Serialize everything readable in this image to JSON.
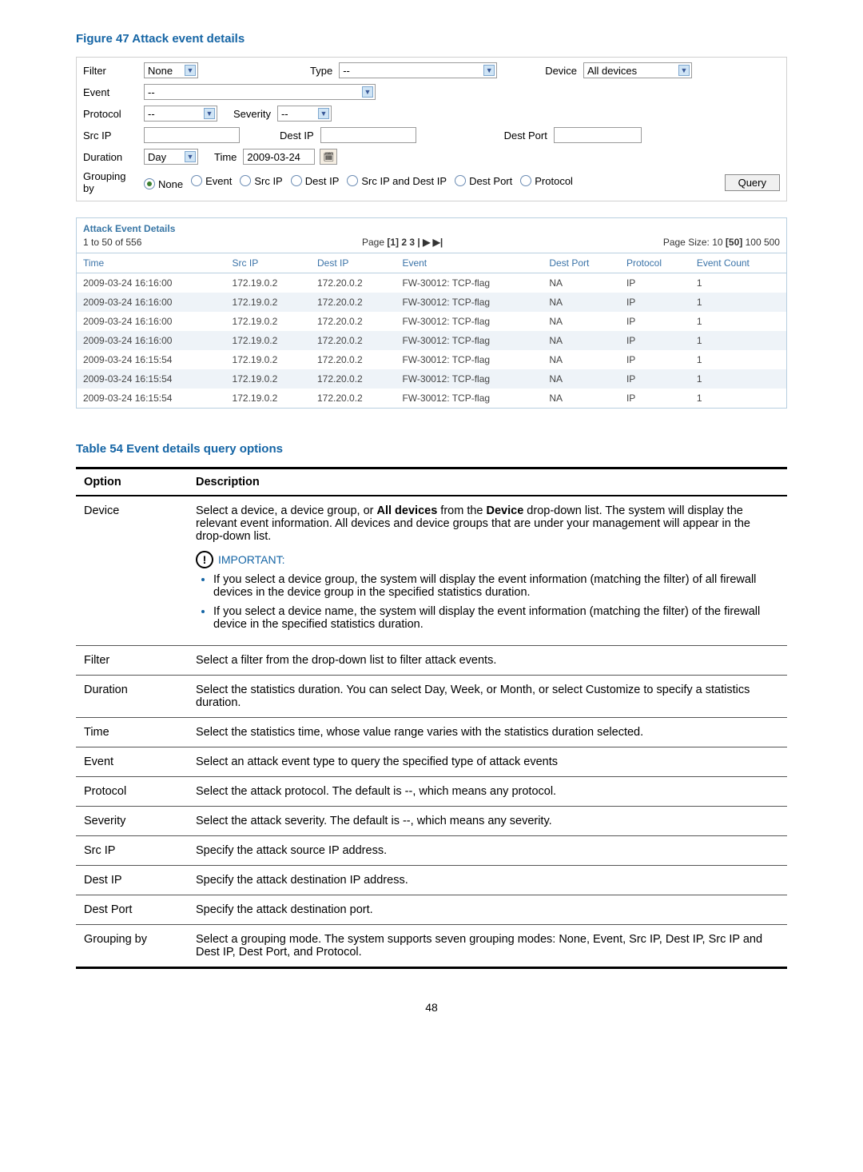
{
  "figure_caption": "Figure 47 Attack event details",
  "filter_panel": {
    "labels": {
      "filter": "Filter",
      "type": "Type",
      "device": "Device",
      "event": "Event",
      "protocol": "Protocol",
      "severity": "Severity",
      "src_ip": "Src IP",
      "dest_ip": "Dest IP",
      "dest_port": "Dest Port",
      "duration": "Duration",
      "time": "Time",
      "grouping_by": "Grouping by"
    },
    "values": {
      "filter": "None",
      "type": "--",
      "device": "All devices",
      "event": "--",
      "protocol": "--",
      "severity": "--",
      "src_ip": "",
      "dest_ip": "",
      "dest_port": "",
      "duration": "Day",
      "time": "2009-03-24"
    },
    "grouping_options": [
      "None",
      "Event",
      "Src IP",
      "Dest IP",
      "Src IP and Dest IP",
      "Dest Port",
      "Protocol"
    ],
    "grouping_selected": "None",
    "query_button": "Query"
  },
  "details": {
    "title": "Attack Event Details",
    "range": "1 to 50 of 556",
    "pager_prefix": "Page",
    "pager_pages": "[1] 2 3 | ▶ ▶|",
    "page_size_label": "Page Size:",
    "page_sizes": [
      "10",
      "[50]",
      "100",
      "500"
    ],
    "columns": [
      "Time",
      "Src IP",
      "Dest IP",
      "Event",
      "Dest Port",
      "Protocol",
      "Event Count"
    ],
    "rows": [
      {
        "time": "2009-03-24 16:16:00",
        "src": "172.19.0.2",
        "dest": "172.20.0.2",
        "event": "FW-30012: TCP-flag",
        "dport": "NA",
        "proto": "IP",
        "count": "1"
      },
      {
        "time": "2009-03-24 16:16:00",
        "src": "172.19.0.2",
        "dest": "172.20.0.2",
        "event": "FW-30012: TCP-flag",
        "dport": "NA",
        "proto": "IP",
        "count": "1"
      },
      {
        "time": "2009-03-24 16:16:00",
        "src": "172.19.0.2",
        "dest": "172.20.0.2",
        "event": "FW-30012: TCP-flag",
        "dport": "NA",
        "proto": "IP",
        "count": "1"
      },
      {
        "time": "2009-03-24 16:16:00",
        "src": "172.19.0.2",
        "dest": "172.20.0.2",
        "event": "FW-30012: TCP-flag",
        "dport": "NA",
        "proto": "IP",
        "count": "1"
      },
      {
        "time": "2009-03-24 16:15:54",
        "src": "172.19.0.2",
        "dest": "172.20.0.2",
        "event": "FW-30012: TCP-flag",
        "dport": "NA",
        "proto": "IP",
        "count": "1"
      },
      {
        "time": "2009-03-24 16:15:54",
        "src": "172.19.0.2",
        "dest": "172.20.0.2",
        "event": "FW-30012: TCP-flag",
        "dport": "NA",
        "proto": "IP",
        "count": "1"
      },
      {
        "time": "2009-03-24 16:15:54",
        "src": "172.19.0.2",
        "dest": "172.20.0.2",
        "event": "FW-30012: TCP-flag",
        "dport": "NA",
        "proto": "IP",
        "count": "1"
      }
    ]
  },
  "table_caption": "Table 54 Event details query options",
  "opts_header": {
    "option": "Option",
    "description": "Description"
  },
  "opts": [
    {
      "opt": "Device",
      "desc_intro": "Select a device, a device group, or <b>All devices</b> from the <b>Device</b> drop-down list. The system will display the relevant event information. All devices and device groups that are under your management will appear in the drop-down list.",
      "important": "IMPORTANT:",
      "bullets": [
        "If you select a device group, the system will display the event information (matching the filter) of all firewall devices in the device group in the specified statistics duration.",
        "If you select a device name, the system will display the event information (matching the filter) of the firewall device in the specified statistics duration."
      ]
    },
    {
      "opt": "Filter",
      "desc": "Select a filter from the drop-down list to filter attack events."
    },
    {
      "opt": "Duration",
      "desc": "Select the statistics duration. You can select Day, Week, or Month, or select Customize to specify a statistics duration."
    },
    {
      "opt": "Time",
      "desc": "Select the statistics time, whose value range varies with the statistics duration selected."
    },
    {
      "opt": "Event",
      "desc": "Select an attack event type to query the specified type of attack events"
    },
    {
      "opt": "Protocol",
      "desc": "Select the attack protocol. The default is --, which means any protocol."
    },
    {
      "opt": "Severity",
      "desc": "Select the attack severity. The default is --, which means any severity."
    },
    {
      "opt": "Src IP",
      "desc": "Specify the attack source IP address."
    },
    {
      "opt": "Dest IP",
      "desc": "Specify the attack destination IP address."
    },
    {
      "opt": "Dest Port",
      "desc": "Specify the attack destination port."
    },
    {
      "opt": "Grouping by",
      "desc": "Select a grouping mode. The system supports seven grouping modes: None, Event, Src IP, Dest IP, Src IP and Dest IP, Dest Port, and Protocol."
    }
  ],
  "page_number": "48"
}
